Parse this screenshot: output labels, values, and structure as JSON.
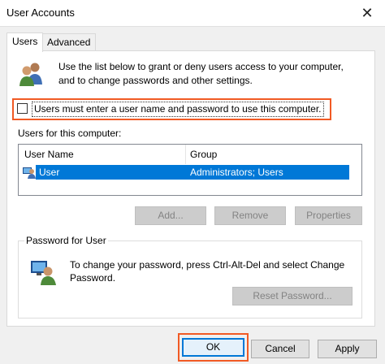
{
  "window": {
    "title": "User Accounts",
    "close_glyph": "✕"
  },
  "tabs": [
    {
      "label": "Users",
      "active": true
    },
    {
      "label": "Advanced",
      "active": false
    }
  ],
  "intro": {
    "line1": "Use the list below to grant or deny users access to your computer,",
    "line2": "and to change passwords and other settings."
  },
  "require_password": {
    "label": "Users must enter a user name and password to use this computer.",
    "checked": false
  },
  "users_section": {
    "label": "Users for this computer:"
  },
  "users_table": {
    "columns": [
      "User Name",
      "Group"
    ],
    "rows": [
      {
        "user": "User",
        "group": "Administrators; Users",
        "selected": true
      }
    ]
  },
  "user_buttons": {
    "add": "Add...",
    "remove": "Remove",
    "properties": "Properties"
  },
  "password_group": {
    "title": "Password for User",
    "line1": "To change your password, press Ctrl-Alt-Del and select Change",
    "line2": "Password.",
    "reset_button": "Reset Password..."
  },
  "footer": {
    "ok": "OK",
    "cancel": "Cancel",
    "apply": "Apply"
  },
  "colors": {
    "highlight": "#f15a24",
    "selection": "#0078d7"
  },
  "icons": {
    "users_icon": "users-icon",
    "user_row_icon": "user-icon",
    "password_icon": "user-password-icon"
  }
}
